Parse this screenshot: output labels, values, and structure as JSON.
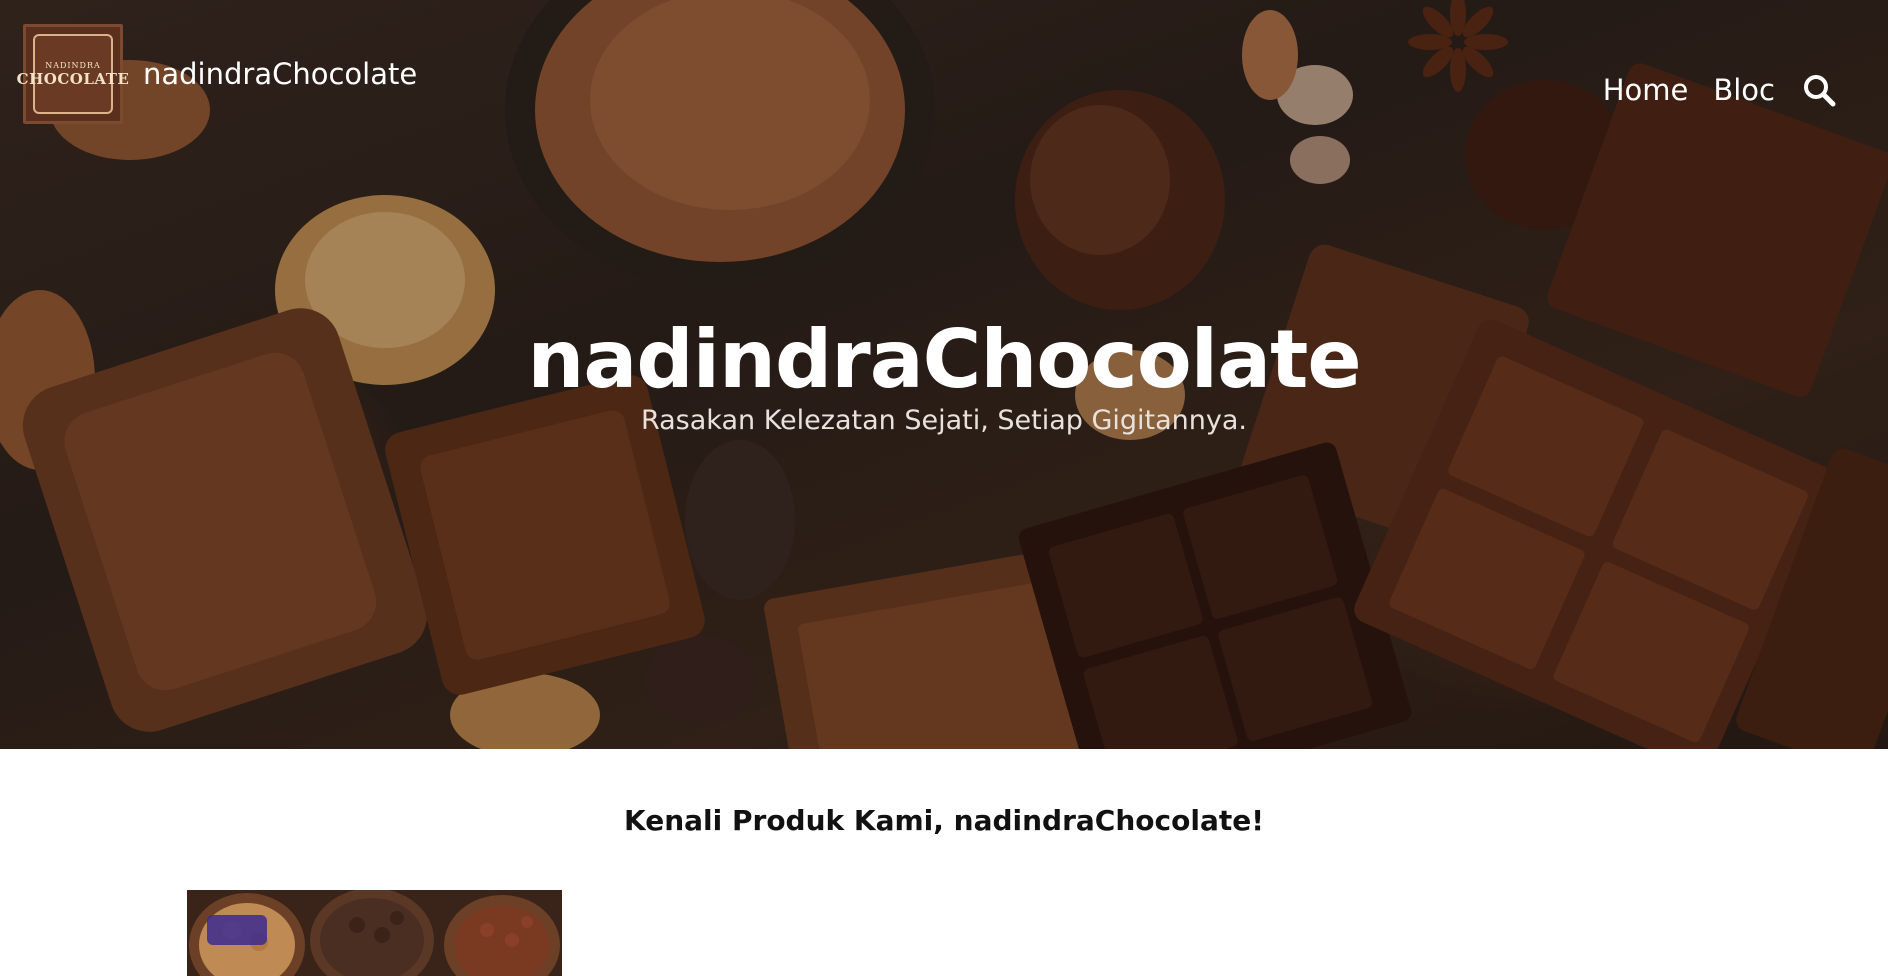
{
  "header": {
    "site_name": "nadindraChocolate",
    "logo": {
      "line1": "NADINDRA",
      "line2": "CHOCOLATE"
    },
    "nav": [
      {
        "label": "Home"
      },
      {
        "label": "Bloc"
      }
    ],
    "search_icon": "search-icon"
  },
  "hero": {
    "title": "nadindraChocolate",
    "subtitle": "Rasakan Kelezatan Sejati, Setiap Gigitannya."
  },
  "main": {
    "heading": "Kenali Produk Kami, nadindraChocolate!"
  },
  "colors": {
    "hero_dark": "#2d211b",
    "chocolate": "#5a2f1d",
    "text_light": "#ffffff",
    "heading_dark": "#111111"
  }
}
